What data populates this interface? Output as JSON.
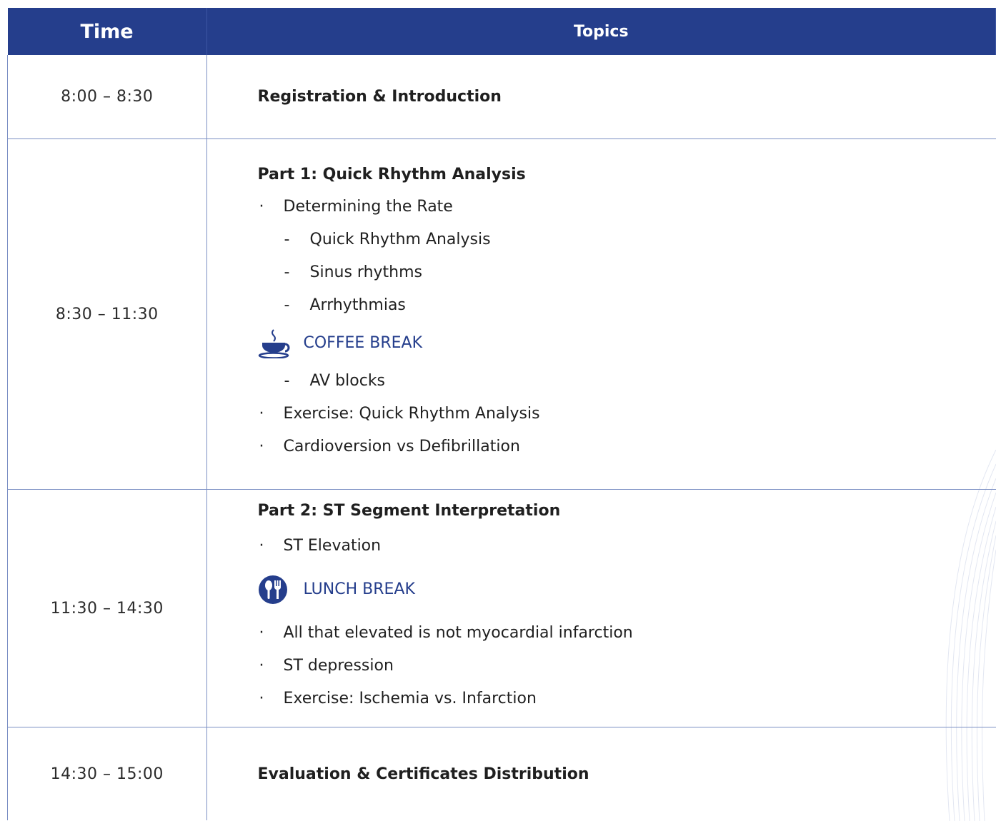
{
  "header": {
    "time": "Time",
    "topics": "Topics"
  },
  "bullet_glyph": "·",
  "dash_glyph": "-",
  "colors": {
    "header_bg": "#253e8c",
    "break_text": "#253e8c",
    "border": "#7b8fc4"
  },
  "rows": [
    {
      "time": "8:00 – 8:30",
      "heading": "Registration & Introduction"
    },
    {
      "time": "8:30 – 11:30",
      "heading": "Part 1: Quick Rhythm Analysis",
      "item1": "Determining the Rate",
      "sub1": "Quick Rhythm Analysis",
      "sub2": "Sinus rhythms",
      "sub3": "Arrhythmias",
      "break_label": "COFFEE BREAK",
      "break_icon": "coffee-cup-icon",
      "sub4": "AV blocks",
      "item2": "Exercise: Quick Rhythm Analysis",
      "item3": "Cardioversion vs Defibrillation"
    },
    {
      "time": "11:30 – 14:30",
      "heading": "Part 2: ST Segment Interpretation",
      "item1": "ST Elevation",
      "break_label": "LUNCH BREAK",
      "break_icon": "fork-spoon-icon",
      "item2": "All that elevated is not myocardial infarction",
      "item3": "ST depression",
      "item4": "Exercise: Ischemia vs. Infarction"
    },
    {
      "time": "14:30 – 15:00",
      "heading": "Evaluation & Certificates Distribution"
    }
  ]
}
